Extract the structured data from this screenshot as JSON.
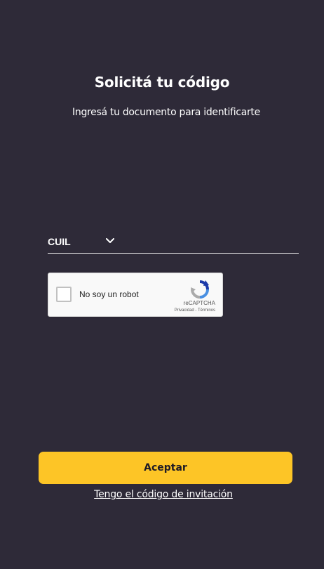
{
  "header": {
    "title": "Solicitá tu código",
    "subtitle": "Ingresá tu documento para identificarte"
  },
  "document_select": {
    "selected": "CUIL",
    "icon": "chevron-down-icon"
  },
  "recaptcha": {
    "label": "No soy un robot",
    "brand": "reCAPTCHA",
    "privacy": "Privacidad",
    "separator": " - ",
    "terms": "Términos",
    "icon": "recaptcha-logo-icon"
  },
  "actions": {
    "accept_label": "Aceptar",
    "invite_link": "Tengo el código de invitación"
  },
  "colors": {
    "background": "#2e2a38",
    "accent": "#fdc526",
    "text": "#ffffff"
  }
}
